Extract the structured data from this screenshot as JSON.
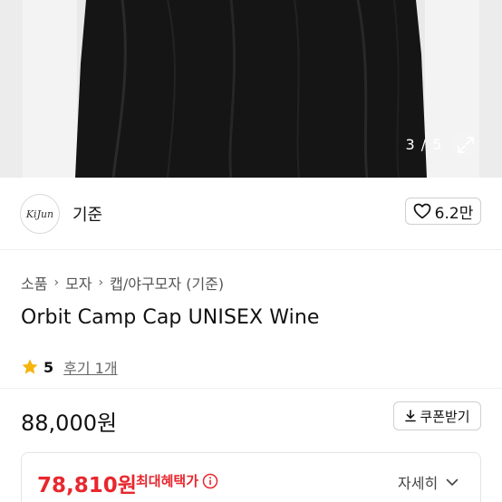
{
  "gallery": {
    "counter": "3 / 5",
    "expand_icon": "expand-icon"
  },
  "seller": {
    "avatar_text": "KiJun",
    "name": "기준",
    "likes": "6.2만",
    "like_icon": "heart-icon"
  },
  "breadcrumb": [
    "소품",
    "모자",
    "캡/야구모자 (기준)"
  ],
  "product": {
    "title": "Orbit Camp Cap UNISEX Wine",
    "rating": "5",
    "reviews": "후기 1개",
    "price": "88,000원"
  },
  "coupon": {
    "label": "쿠폰받기",
    "icon": "download-icon"
  },
  "benefit": {
    "price": "78,810원",
    "label": "최대혜택가",
    "detail_label": "자세히"
  },
  "colors": {
    "accent_red": "#e8272e",
    "star": "#f6b40c"
  }
}
